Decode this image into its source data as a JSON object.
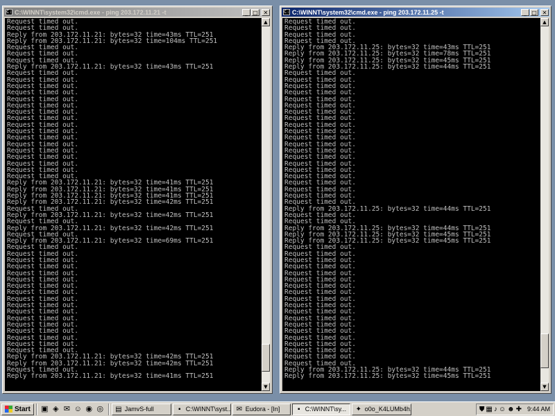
{
  "window_left": {
    "title": "C:\\WINNT\\system32\\cmd.exe - ping 203.172.11.21 -t",
    "console_lines": [
      "Request timed out.",
      "Request timed out.",
      "Reply from 203.172.11.21: bytes=32 time=43ms TTL=251",
      "Reply from 203.172.11.21: bytes=32 time=104ms TTL=251",
      "Request timed out.",
      "Request timed out.",
      "Request timed out.",
      "Reply from 203.172.11.21: bytes=32 time=43ms TTL=251",
      "Request timed out.",
      "Request timed out.",
      "Request timed out.",
      "Request timed out.",
      "Request timed out.",
      "Request timed out.",
      "Request timed out.",
      "Request timed out.",
      "Request timed out.",
      "Request timed out.",
      "Request timed out.",
      "Request timed out.",
      "Request timed out.",
      "Request timed out.",
      "Request timed out.",
      "Request timed out.",
      "Request timed out.",
      "Reply from 203.172.11.21: bytes=32 time=41ms TTL=251",
      "Reply from 203.172.11.21: bytes=32 time=41ms TTL=251",
      "Reply from 203.172.11.21: bytes=32 time=41ms TTL=251",
      "Reply from 203.172.11.21: bytes=32 time=42ms TTL=251",
      "Request timed out.",
      "Reply from 203.172.11.21: bytes=32 time=42ms TTL=251",
      "Request timed out.",
      "Reply from 203.172.11.21: bytes=32 time=42ms TTL=251",
      "Request timed out.",
      "Reply from 203.172.11.21: bytes=32 time=69ms TTL=251",
      "Request timed out.",
      "Request timed out.",
      "Request timed out.",
      "Request timed out.",
      "Request timed out.",
      "Request timed out.",
      "Request timed out.",
      "Request timed out.",
      "Request timed out.",
      "Request timed out.",
      "Request timed out.",
      "Request timed out.",
      "Request timed out.",
      "Request timed out.",
      "Request timed out.",
      "Request timed out.",
      "Request timed out.",
      "Reply from 203.172.11.21: bytes=32 time=42ms TTL=251",
      "Reply from 203.172.11.21: bytes=32 time=42ms TTL=251",
      "Request timed out.",
      "Reply from 203.172.11.21: bytes=32 time=41ms TTL=251"
    ]
  },
  "window_right": {
    "title": "C:\\WINNT\\system32\\cmd.exe - ping 203.172.11.25 -t",
    "console_lines": [
      "Request timed out.",
      "Request timed out.",
      "Request timed out.",
      "Request timed out.",
      "Reply from 203.172.11.25: bytes=32 time=43ms TTL=251",
      "Reply from 203.172.11.25: bytes=32 time=78ms TTL=251",
      "Reply from 203.172.11.25: bytes=32 time=45ms TTL=251",
      "Reply from 203.172.11.25: bytes=32 time=44ms TTL=251",
      "Request timed out.",
      "Request timed out.",
      "Request timed out.",
      "Request timed out.",
      "Request timed out.",
      "Request timed out.",
      "Request timed out.",
      "Request timed out.",
      "Request timed out.",
      "Request timed out.",
      "Request timed out.",
      "Request timed out.",
      "Request timed out.",
      "Request timed out.",
      "Request timed out.",
      "Request timed out.",
      "Request timed out.",
      "Request timed out.",
      "Request timed out.",
      "Request timed out.",
      "Request timed out.",
      "Reply from 203.172.11.25: bytes=32 time=44ms TTL=251",
      "Request timed out.",
      "Request timed out.",
      "Reply from 203.172.11.25: bytes=32 time=44ms TTL=251",
      "Reply from 203.172.11.25: bytes=32 time=45ms TTL=251",
      "Reply from 203.172.11.25: bytes=32 time=45ms TTL=251",
      "Request timed out.",
      "Request timed out.",
      "Request timed out.",
      "Request timed out.",
      "Request timed out.",
      "Request timed out.",
      "Request timed out.",
      "Request timed out.",
      "Request timed out.",
      "Request timed out.",
      "Request timed out.",
      "Request timed out.",
      "Request timed out.",
      "Request timed out.",
      "Request timed out.",
      "Request timed out.",
      "Request timed out.",
      "Request timed out.",
      "Request timed out.",
      "Reply from 203.172.11.25: bytes=32 time=44ms TTL=251",
      "Reply from 203.172.11.25: bytes=32 time=45ms TTL=251"
    ]
  },
  "taskbar": {
    "start_label": "Start",
    "quick_launch": [
      {
        "icon": "desktop-icon",
        "glyph": "▣"
      },
      {
        "icon": "explorer-icon",
        "glyph": "◈"
      },
      {
        "icon": "email-icon",
        "glyph": "✉"
      },
      {
        "icon": "messenger-icon",
        "glyph": "☺"
      },
      {
        "icon": "chrome-icon",
        "glyph": "◉"
      },
      {
        "icon": "firefox-icon",
        "glyph": "◎"
      }
    ],
    "tasks": [
      {
        "label": "JamvS-full",
        "icon": "folder-icon",
        "glyph": "▤",
        "pressed": false,
        "width": 86
      },
      {
        "label": "C:\\WINNT\\syst...",
        "icon": "cmd-icon",
        "glyph": "▪",
        "pressed": false,
        "width": 84
      },
      {
        "label": "Eudora - [In]",
        "icon": "eudora-icon",
        "glyph": "✉",
        "pressed": false,
        "width": 84
      },
      {
        "label": "C:\\WINNT\\sy...",
        "icon": "cmd-icon",
        "glyph": "▪",
        "pressed": true,
        "width": 84
      },
      {
        "label": "o0o_K4LUMb4h...",
        "icon": "chat-icon",
        "glyph": "✦",
        "pressed": false,
        "width": 86
      }
    ],
    "tray_icons": [
      {
        "icon": "shield-icon",
        "glyph": "⛊"
      },
      {
        "icon": "network-icon",
        "glyph": "▦"
      },
      {
        "icon": "speaker-icon",
        "glyph": "♪"
      },
      {
        "icon": "messenger-tray-icon",
        "glyph": "☺"
      },
      {
        "icon": "yahoo-tray-icon",
        "glyph": "☻"
      },
      {
        "icon": "antivirus-icon",
        "glyph": "✚"
      }
    ],
    "clock": "9:44 AM"
  }
}
